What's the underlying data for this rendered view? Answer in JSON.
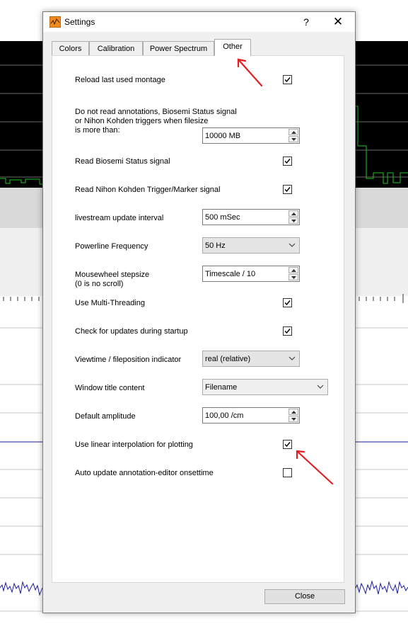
{
  "dialog": {
    "title": "Settings",
    "help": "?",
    "close_icon": "✕"
  },
  "tabs": [
    {
      "label": "Colors",
      "active": false
    },
    {
      "label": "Calibration",
      "active": false
    },
    {
      "label": "Power Spectrum",
      "active": false
    },
    {
      "label": "Other",
      "active": true
    }
  ],
  "settings": {
    "reload_montage": {
      "label": "Reload last used montage",
      "checked": true
    },
    "annotations": {
      "label_line1": "Do not read annotations, Biosemi Status signal",
      "label_line2": "or Nihon Kohden triggers when filesize",
      "label_line3": "is more than:",
      "value": "10000 MB"
    },
    "biosemi": {
      "label": "Read Biosemi Status signal",
      "checked": true
    },
    "nihon": {
      "label": "Read Nihon Kohden Trigger/Marker signal",
      "checked": true
    },
    "livestream": {
      "label": "livestream update interval",
      "value": "500 mSec"
    },
    "powerline": {
      "label": "Powerline Frequency",
      "value": "50 Hz"
    },
    "mousewheel": {
      "label_line1": "Mousewheel stepsize",
      "label_line2": "(0 is no scroll)",
      "value": "Timescale / 10"
    },
    "multithreading": {
      "label": "Use Multi-Threading",
      "checked": true
    },
    "updates": {
      "label": "Check for updates during startup",
      "checked": true
    },
    "viewtime": {
      "label": "Viewtime / fileposition indicator",
      "value": "real (relative)"
    },
    "window_title": {
      "label": "Window title content",
      "value": "Filename"
    },
    "amplitude": {
      "label": "Default amplitude",
      "value": "100,00 /cm"
    },
    "interpolation": {
      "label": "Use linear interpolation for plotting",
      "checked": true
    },
    "auto_update": {
      "label": "Auto update annotation-editor onsettime",
      "checked": false
    }
  },
  "close_button": "Close",
  "colors": {
    "annotation_arrow": "#e02020",
    "signal_green": "#22c322",
    "trace_blue": "#1a1aa8"
  }
}
